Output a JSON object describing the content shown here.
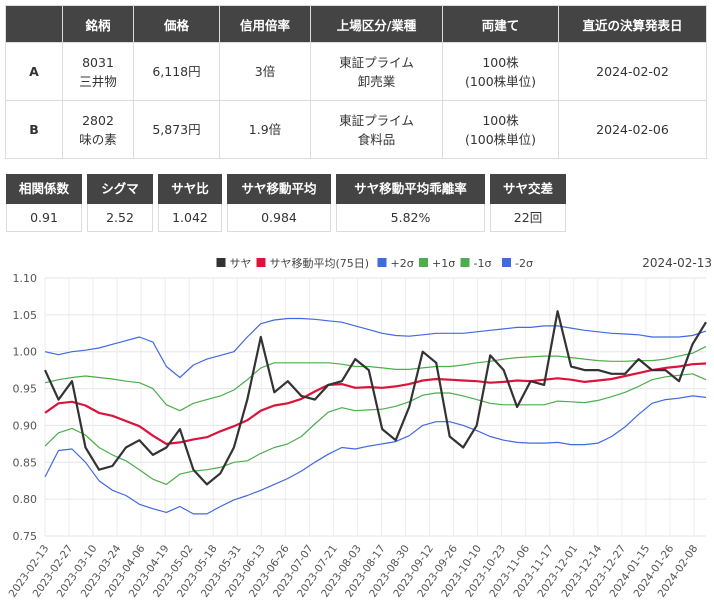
{
  "pairs_table": {
    "headers": [
      "",
      "銘柄",
      "価格",
      "信用倍率",
      "上場区分/業種",
      "両建て",
      "直近の決算発表日"
    ],
    "rows": [
      {
        "label": "A",
        "code": "8031",
        "name": "三井物",
        "price": "6,118円",
        "margin_ratio": "3倍",
        "market": "東証プライム",
        "sector": "卸売業",
        "hedge_qty": "100株",
        "hedge_unit": "(100株単位)",
        "earnings_date": "2024-02-02"
      },
      {
        "label": "B",
        "code": "2802",
        "name": "味の素",
        "price": "5,873円",
        "margin_ratio": "1.9倍",
        "market": "東証プライム",
        "sector": "食料品",
        "hedge_qty": "100株",
        "hedge_unit": "(100株単位)",
        "earnings_date": "2024-02-06"
      }
    ]
  },
  "stats": [
    {
      "label": "相関係数",
      "value": "0.91"
    },
    {
      "label": "シグマ",
      "value": "2.52"
    },
    {
      "label": "サヤ比",
      "value": "1.042"
    },
    {
      "label": "サヤ移動平均",
      "value": "0.984"
    },
    {
      "label": "サヤ移動平均乖離率",
      "value": "5.82%"
    },
    {
      "label": "サヤ交差",
      "value": "22回"
    }
  ],
  "chart": {
    "date_label": "2024-02-13",
    "legend": [
      {
        "key": "spread",
        "label": "サヤ",
        "color": "#333333"
      },
      {
        "key": "ma",
        "label": "サヤ移動平均(75日)",
        "color": "#dc143c"
      },
      {
        "key": "p2",
        "label": "+2σ",
        "color": "#4169e1"
      },
      {
        "key": "p1",
        "label": "+1σ",
        "color": "#4cae4c"
      },
      {
        "key": "m1",
        "label": "-1σ",
        "color": "#4cae4c"
      },
      {
        "key": "m2",
        "label": "-2σ",
        "color": "#4169e1"
      }
    ]
  },
  "chart_data": {
    "type": "line",
    "ylim": [
      0.75,
      1.1
    ],
    "y_ticks": [
      "1.10",
      "1.05",
      "1.00",
      "0.95",
      "0.90",
      "0.85",
      "0.80",
      "0.75"
    ],
    "x_ticks": [
      "2023-02-13",
      "2023-02-27",
      "2023-03-10",
      "2023-03-24",
      "2023-04-06",
      "2023-04-19",
      "2023-05-02",
      "2023-05-18",
      "2023-05-31",
      "2023-06-13",
      "2023-06-26",
      "2023-07-07",
      "2023-07-21",
      "2023-08-03",
      "2023-08-17",
      "2023-08-30",
      "2023-09-12",
      "2023-09-26",
      "2023-10-10",
      "2023-10-23",
      "2023-11-06",
      "2023-11-17",
      "2023-12-01",
      "2023-12-14",
      "2023-12-27",
      "2024-01-15",
      "2024-01-26",
      "2024-02-08"
    ],
    "grid": true,
    "legend_position": "top",
    "series": [
      {
        "name": "サヤ",
        "key": "spread",
        "values": [
          0.975,
          0.935,
          0.96,
          0.87,
          0.84,
          0.845,
          0.87,
          0.88,
          0.86,
          0.87,
          0.895,
          0.84,
          0.82,
          0.835,
          0.87,
          0.935,
          1.02,
          0.945,
          0.96,
          0.94,
          0.935,
          0.955,
          0.96,
          0.99,
          0.975,
          0.895,
          0.88,
          0.925,
          1.0,
          0.985,
          0.885,
          0.87,
          0.9,
          0.995,
          0.975,
          0.925,
          0.96,
          0.955,
          1.055,
          0.98,
          0.975,
          0.975,
          0.97,
          0.97,
          0.99,
          0.975,
          0.975,
          0.96,
          1.01,
          1.04
        ]
      },
      {
        "name": "サヤ移動平均(75日)",
        "key": "ma",
        "values": [
          0.917,
          0.93,
          0.932,
          0.927,
          0.917,
          0.913,
          0.906,
          0.899,
          0.886,
          0.875,
          0.877,
          0.881,
          0.884,
          0.892,
          0.899,
          0.907,
          0.92,
          0.927,
          0.93,
          0.936,
          0.946,
          0.955,
          0.956,
          0.951,
          0.952,
          0.951,
          0.953,
          0.956,
          0.961,
          0.963,
          0.962,
          0.961,
          0.96,
          0.958,
          0.959,
          0.961,
          0.96,
          0.962,
          0.964,
          0.962,
          0.959,
          0.961,
          0.963,
          0.967,
          0.971,
          0.975,
          0.978,
          0.98,
          0.983,
          0.984
        ]
      },
      {
        "name": "+2σ",
        "key": "p2",
        "values": [
          1.0,
          0.996,
          1.0,
          1.002,
          1.005,
          1.01,
          1.015,
          1.02,
          1.013,
          0.98,
          0.965,
          0.982,
          0.99,
          0.995,
          1.0,
          1.02,
          1.038,
          1.043,
          1.045,
          1.045,
          1.044,
          1.042,
          1.04,
          1.035,
          1.03,
          1.025,
          1.022,
          1.021,
          1.023,
          1.025,
          1.025,
          1.025,
          1.027,
          1.029,
          1.031,
          1.033,
          1.033,
          1.035,
          1.035,
          1.032,
          1.029,
          1.027,
          1.025,
          1.024,
          1.023,
          1.02,
          1.02,
          1.02,
          1.022,
          1.028
        ]
      },
      {
        "name": "+1σ",
        "key": "p1",
        "values": [
          0.958,
          0.962,
          0.965,
          0.967,
          0.965,
          0.963,
          0.96,
          0.958,
          0.95,
          0.928,
          0.92,
          0.93,
          0.935,
          0.94,
          0.948,
          0.962,
          0.978,
          0.985,
          0.985,
          0.985,
          0.985,
          0.985,
          0.983,
          0.98,
          0.98,
          0.978,
          0.976,
          0.976,
          0.978,
          0.98,
          0.98,
          0.982,
          0.985,
          0.987,
          0.99,
          0.992,
          0.993,
          0.994,
          0.994,
          0.992,
          0.99,
          0.988,
          0.987,
          0.987,
          0.988,
          0.988,
          0.99,
          0.994,
          0.998,
          1.007
        ]
      },
      {
        "name": "-1σ",
        "key": "m1",
        "values": [
          0.872,
          0.89,
          0.896,
          0.887,
          0.87,
          0.86,
          0.852,
          0.84,
          0.827,
          0.82,
          0.834,
          0.838,
          0.84,
          0.843,
          0.85,
          0.852,
          0.862,
          0.87,
          0.875,
          0.885,
          0.902,
          0.918,
          0.924,
          0.92,
          0.921,
          0.922,
          0.926,
          0.932,
          0.941,
          0.944,
          0.944,
          0.94,
          0.935,
          0.93,
          0.928,
          0.928,
          0.928,
          0.928,
          0.933,
          0.932,
          0.931,
          0.934,
          0.939,
          0.945,
          0.953,
          0.962,
          0.966,
          0.968,
          0.97,
          0.962
        ]
      },
      {
        "name": "-2σ",
        "key": "m2",
        "values": [
          0.83,
          0.866,
          0.868,
          0.85,
          0.825,
          0.812,
          0.805,
          0.793,
          0.787,
          0.782,
          0.79,
          0.78,
          0.78,
          0.79,
          0.799,
          0.805,
          0.812,
          0.82,
          0.828,
          0.838,
          0.85,
          0.861,
          0.87,
          0.868,
          0.872,
          0.875,
          0.878,
          0.886,
          0.9,
          0.905,
          0.905,
          0.9,
          0.893,
          0.885,
          0.88,
          0.877,
          0.876,
          0.876,
          0.877,
          0.874,
          0.874,
          0.876,
          0.885,
          0.898,
          0.915,
          0.93,
          0.935,
          0.937,
          0.94,
          0.938
        ]
      }
    ]
  }
}
